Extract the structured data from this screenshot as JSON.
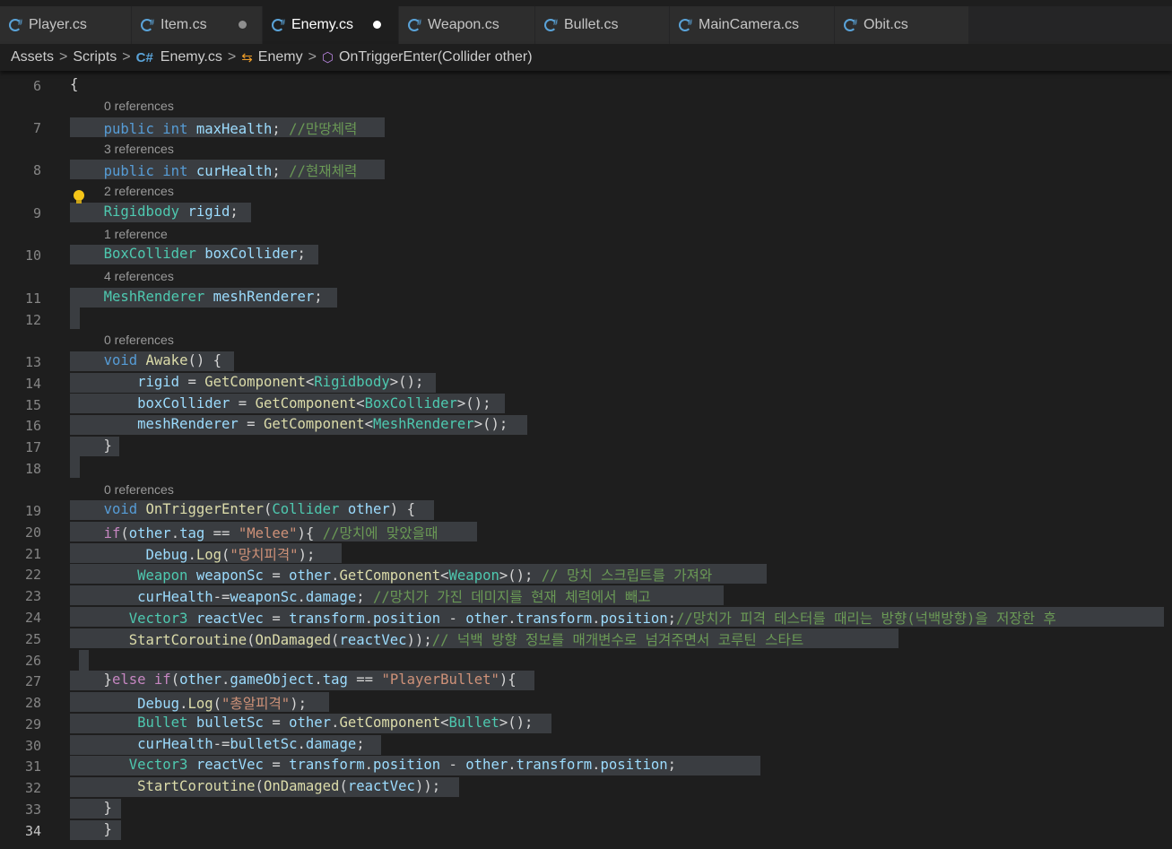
{
  "tabs": [
    {
      "label": "Player.cs",
      "modified": false,
      "active": false
    },
    {
      "label": "Item.cs",
      "modified": true,
      "active": false
    },
    {
      "label": "Enemy.cs",
      "modified": true,
      "active": true
    },
    {
      "label": "Weapon.cs",
      "modified": false,
      "active": false
    },
    {
      "label": "Bullet.cs",
      "modified": false,
      "active": false
    },
    {
      "label": "MainCamera.cs",
      "modified": false,
      "active": false
    },
    {
      "label": "Obit.cs",
      "modified": false,
      "active": false
    }
  ],
  "breadcrumb": {
    "items": [
      "Assets",
      "Scripts",
      "Enemy.cs",
      "Enemy",
      "OnTriggerEnter(Collider other)"
    ],
    "separator": ">"
  },
  "colors": {
    "background": "#1e1e1e",
    "keyword": "#569cd6",
    "type": "#4ec9b0",
    "comment": "#6a9955",
    "string": "#ce9178",
    "function": "#dcdcaa",
    "variable": "#9cdcfe",
    "control": "#c586c0",
    "selection": "#3a3d41"
  },
  "icons": {
    "tab_file": "csharp-file-icon",
    "class": "class-icon",
    "method": "method-cube-icon",
    "hint": "lightbulb-icon"
  },
  "editor": {
    "current_line": "34",
    "code_lens": {
      "l7": "0 references",
      "l8": "3 references",
      "l9": "2 references",
      "l10": "1 reference",
      "l11": "4 references",
      "l13": "0 references",
      "l19": "0 references"
    },
    "lines": {
      "l6": "{",
      "l7": "    public int maxHealth; //만땅체력",
      "l8": "    public int curHealth; //현재체력",
      "l9": "    Rigidbody rigid;",
      "l10": "    BoxCollider boxCollider;",
      "l11": "    MeshRenderer meshRenderer;",
      "l12": "",
      "l13": "    void Awake() {",
      "l14": "        rigid = GetComponent<Rigidbody>();",
      "l15": "        boxCollider = GetComponent<BoxCollider>();",
      "l16": "        meshRenderer = GetComponent<MeshRenderer>();",
      "l17": "    }",
      "l18": "",
      "l19": "    void OnTriggerEnter(Collider other) {",
      "l20": "    if(other.tag == \"Melee\"){ //망치에 맞았을때",
      "l21": "         Debug.Log(\"망치피격\");",
      "l22": "        Weapon weaponSc = other.GetComponent<Weapon>(); // 망치 스크립트를 가져와",
      "l23": "        curHealth-=weaponSc.damage; //망치가 가진 데미지를 현재 체력에서 빼고",
      "l24": "       Vector3 reactVec = transform.position - other.transform.position;//망치가 피격 테스터를 때리는 방향(넉백방향)을 저장한 후",
      "l25": "       StartCoroutine(OnDamaged(reactVec));// 넉백 방향 정보를 매개변수로 넘겨주면서 코루틴 스타트",
      "l26": "",
      "l27": "    }else if(other.gameObject.tag == \"PlayerBullet\"){",
      "l28": "        Debug.Log(\"총알피격\");",
      "l29": "        Bullet bulletSc = other.GetComponent<Bullet>();",
      "l30": "        curHealth-=bulletSc.damage;",
      "l31": "       Vector3 reactVec = transform.position - other.transform.position;",
      "l32": "        StartCoroutine(OnDamaged(reactVec));",
      "l33": "    }",
      "l34": "    }"
    }
  }
}
